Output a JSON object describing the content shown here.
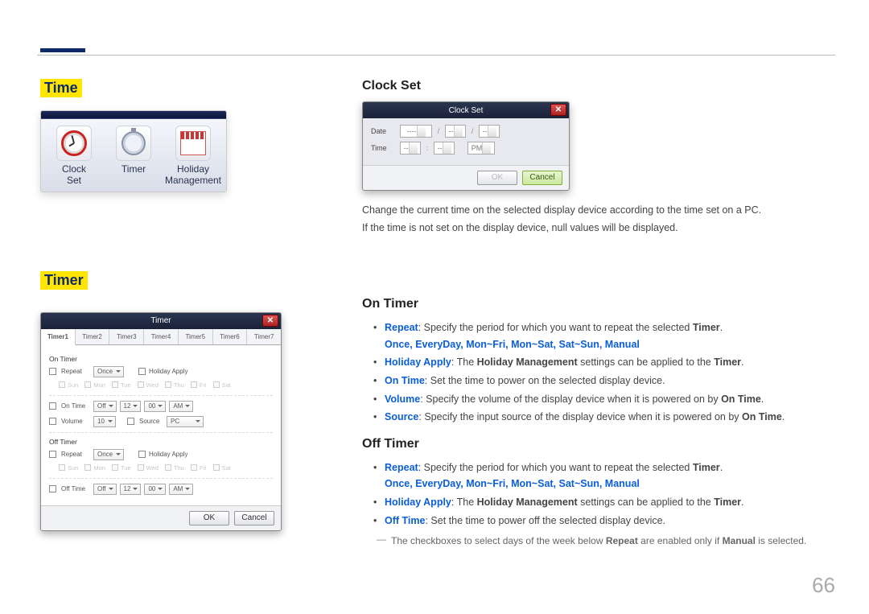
{
  "page_number": "66",
  "left": {
    "time_heading": "Time",
    "timer_heading": "Timer",
    "time_card": {
      "items": [
        {
          "label": "Clock\nSet"
        },
        {
          "label": "Timer"
        },
        {
          "label": "Holiday\nManagement"
        }
      ]
    },
    "timer_dialog": {
      "title": "Timer",
      "close_glyph": "✕",
      "tabs": [
        "Timer1",
        "Timer2",
        "Timer3",
        "Timer4",
        "Timer5",
        "Timer6",
        "Timer7"
      ],
      "on_timer_label": "On Timer",
      "off_timer_label": "Off Timer",
      "repeat_label": "Repeat",
      "repeat_value": "Once",
      "holiday_apply_label": "Holiday Apply",
      "days": [
        "Sun",
        "Mon",
        "Tue",
        "Wed",
        "Thu",
        "Fri",
        "Sat"
      ],
      "on_time_label": "On Time",
      "on_time_enabled": "Off",
      "on_time_hour": "12",
      "on_time_min": "00",
      "on_time_ampm": "AM",
      "volume_label": "Volume",
      "volume_value": "10",
      "source_label": "Source",
      "source_value": "PC",
      "off_time_label": "Off Time",
      "off_time_enabled": "Off",
      "off_time_hour": "12",
      "off_time_min": "00",
      "off_time_ampm": "AM",
      "ok_label": "OK",
      "cancel_label": "Cancel"
    }
  },
  "right": {
    "clock_set": {
      "heading": "Clock Set",
      "dialog": {
        "title": "Clock Set",
        "close_glyph": "✕",
        "date_label": "Date",
        "date_val1": "----",
        "date_val2": "--",
        "date_val3": "--",
        "date_sep": "/",
        "time_label": "Time",
        "time_val1": "--",
        "time_val2": "--",
        "time_ampm": "PM",
        "time_sep": ":",
        "ok_label": "OK",
        "cancel_label": "Cancel"
      },
      "desc1": "Change the current time on the selected display device according to the time set on a PC.",
      "desc2": "If the time is not set on the display device, null values will be displayed."
    },
    "on_timer": {
      "heading": "On Timer",
      "bullets": {
        "repeat_kw": "Repeat",
        "repeat_rest": ": Specify the period for which you want to repeat the selected ",
        "repeat_timer": "Timer",
        "repeat_period": ".",
        "options": "Once, EveryDay, Mon~Fri, Mon~Sat, Sat~Sun, Manual",
        "holiday_apply_kw": "Holiday Apply",
        "holiday_apply_rest1": ": The ",
        "holiday_apply_hm": "Holiday Management",
        "holiday_apply_rest2": " settings can be applied to the ",
        "holiday_apply_timer": "Timer",
        "holiday_apply_period": ".",
        "on_time_kw": "On Time",
        "on_time_rest": ": Set the time to power on the selected display device.",
        "volume_kw": "Volume",
        "volume_rest": ": Specify the volume of the display device when it is powered on by ",
        "volume_ontime": "On Time",
        "volume_period": ".",
        "source_kw": "Source",
        "source_rest": ": Specify the input source of the display device when it is powered on by ",
        "source_ontime": "On Time",
        "source_period": "."
      }
    },
    "off_timer": {
      "heading": "Off Timer",
      "bullets": {
        "repeat_kw": "Repeat",
        "repeat_rest": ": Specify the period for which you want to repeat the selected ",
        "repeat_timer": "Timer",
        "repeat_period": ".",
        "options": "Once, EveryDay, Mon~Fri, Mon~Sat, Sat~Sun, Manual",
        "holiday_apply_kw": "Holiday Apply",
        "holiday_apply_rest1": ": The ",
        "holiday_apply_hm": "Holiday Management",
        "holiday_apply_rest2": " settings can be applied to the ",
        "holiday_apply_timer": "Timer",
        "holiday_apply_period": ".",
        "off_time_kw": "Off Time",
        "off_time_rest": ": Set the time to power off the selected display device."
      },
      "note_pre": "The checkboxes to select days of the week below ",
      "note_repeat": "Repeat",
      "note_mid": " are enabled only if ",
      "note_manual": "Manual",
      "note_post": " is selected."
    }
  }
}
